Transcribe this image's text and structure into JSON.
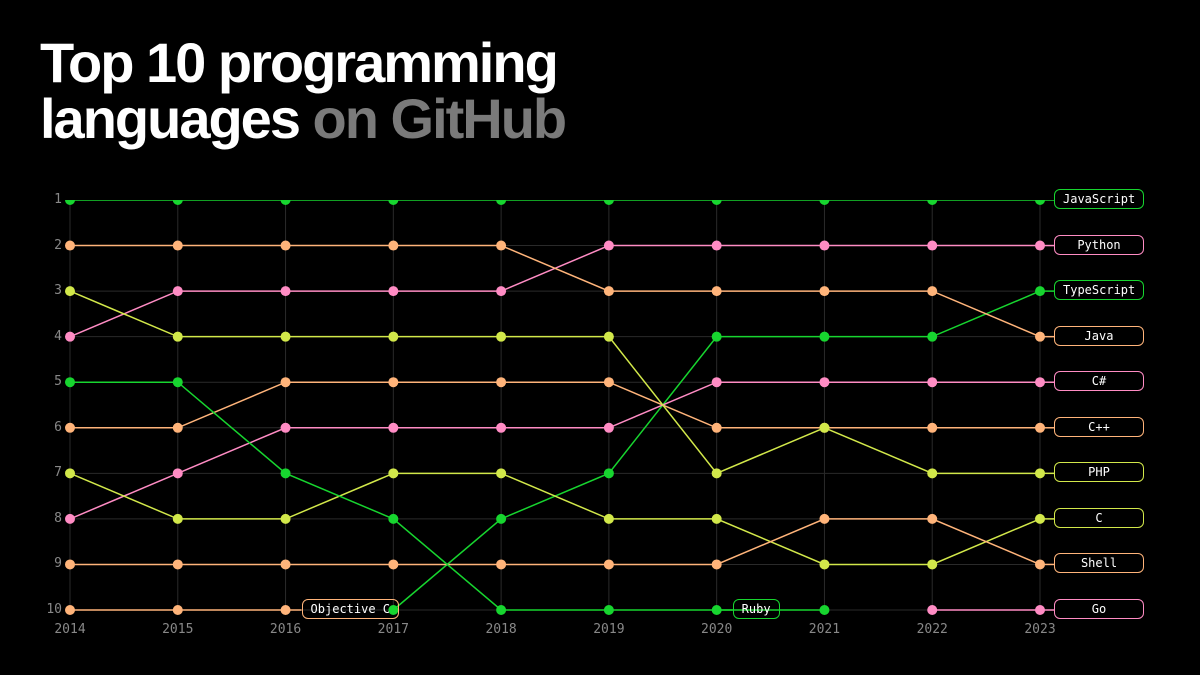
{
  "title_line1": "Top 10 programming",
  "title_line2a": "languages",
  "title_line2b": "on GitHub",
  "chart_data": {
    "type": "line",
    "title": "Top 10 programming languages on GitHub",
    "xlabel": "",
    "ylabel": "",
    "x": [
      2014,
      2015,
      2016,
      2017,
      2018,
      2019,
      2020,
      2021,
      2022,
      2023
    ],
    "ylim": [
      10,
      1
    ],
    "series": [
      {
        "name": "JavaScript",
        "color": "#17d52f",
        "values": [
          1,
          1,
          1,
          1,
          1,
          1,
          1,
          1,
          1,
          1
        ]
      },
      {
        "name": "Python",
        "color": "#ff8cc4",
        "values": [
          4,
          3,
          3,
          3,
          3,
          2,
          2,
          2,
          2,
          2
        ]
      },
      {
        "name": "TypeScript",
        "color": "#17d52f",
        "values": [
          null,
          null,
          null,
          10,
          8,
          7,
          4,
          4,
          4,
          3
        ]
      },
      {
        "name": "Java",
        "color": "#ffb47a",
        "values": [
          2,
          2,
          2,
          2,
          2,
          3,
          3,
          3,
          3,
          4
        ]
      },
      {
        "name": "C#",
        "color": "#ff8cc4",
        "values": [
          8,
          7,
          6,
          6,
          6,
          6,
          5,
          5,
          5,
          5
        ]
      },
      {
        "name": "C++",
        "color": "#ffb47a",
        "values": [
          6,
          6,
          5,
          5,
          5,
          5,
          6,
          6,
          6,
          6
        ]
      },
      {
        "name": "PHP",
        "color": "#d2e84a",
        "values": [
          3,
          4,
          4,
          4,
          4,
          4,
          7,
          6,
          7,
          7
        ]
      },
      {
        "name": "C",
        "color": "#d2e84a",
        "values": [
          7,
          8,
          8,
          7,
          7,
          8,
          8,
          9,
          9,
          8
        ]
      },
      {
        "name": "Shell",
        "color": "#ffb47a",
        "values": [
          9,
          9,
          9,
          9,
          9,
          9,
          9,
          8,
          8,
          9
        ]
      },
      {
        "name": "Go",
        "color": "#ff8cc4",
        "values": [
          null,
          null,
          null,
          null,
          null,
          null,
          null,
          null,
          10,
          10
        ]
      },
      {
        "name": "Ruby",
        "color": "#17d52f",
        "values": [
          5,
          5,
          7,
          8,
          10,
          10,
          10,
          10,
          null,
          null
        ],
        "end_label_year": 2020
      },
      {
        "name": "Objective C",
        "color": "#ffb47a",
        "values": [
          10,
          10,
          10,
          null,
          null,
          null,
          null,
          null,
          null,
          null
        ],
        "end_label_year": 2016
      }
    ],
    "right_labels": [
      "JavaScript",
      "Python",
      "TypeScript",
      "Java",
      "C#",
      "C++",
      "PHP",
      "C",
      "Shell",
      "Go"
    ]
  }
}
